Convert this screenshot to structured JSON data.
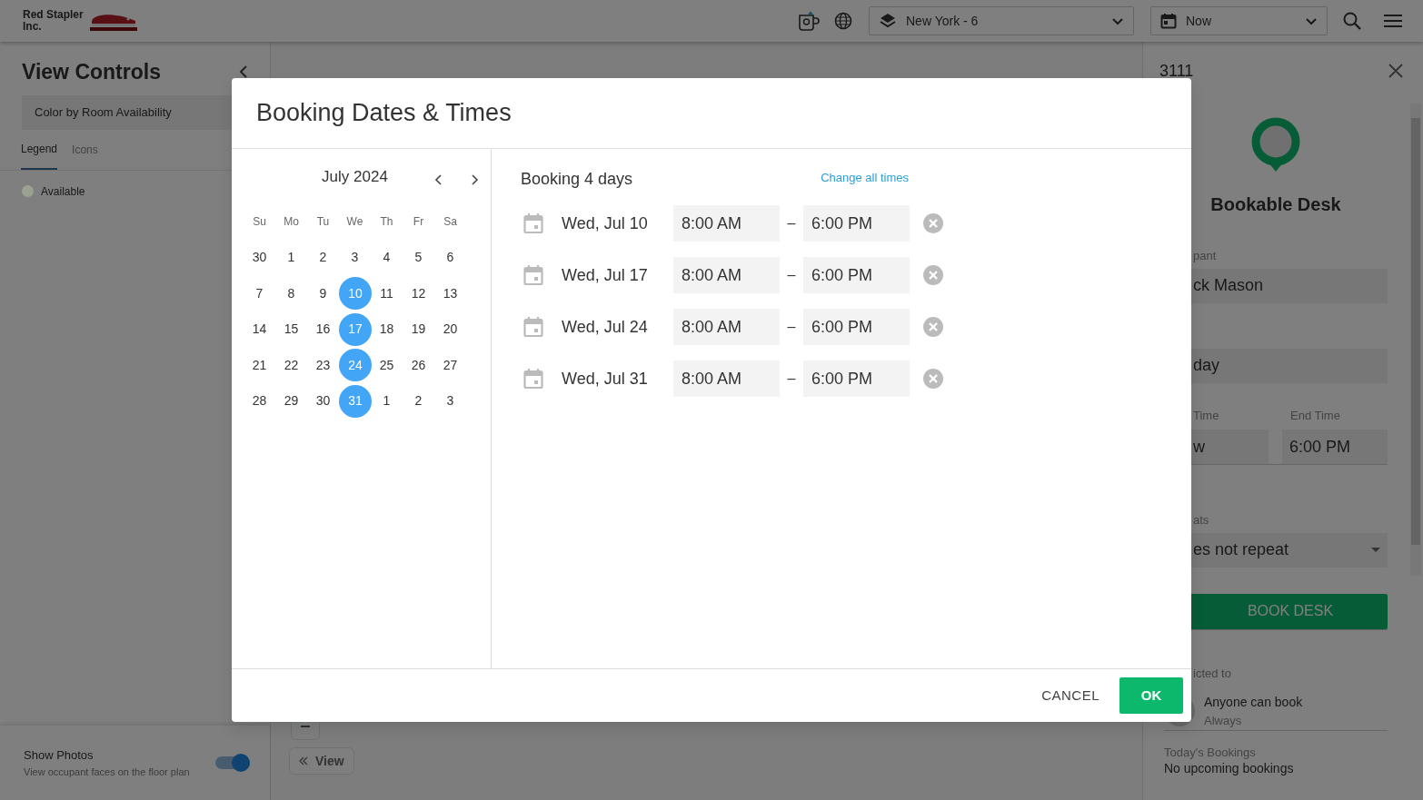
{
  "header": {
    "logo_text": "Red Stapler Inc.",
    "location_select": {
      "value": "New York - 6"
    },
    "time_select": {
      "value": "Now"
    }
  },
  "view_controls": {
    "title": "View Controls",
    "color_select": {
      "value": "Color by Room Availability"
    },
    "tabs": [
      {
        "label": "Legend",
        "selected": true
      },
      {
        "label": "Icons",
        "selected": false
      }
    ],
    "legend": [
      {
        "label": "Available",
        "color": "#9aa38f"
      }
    ],
    "show_photos": {
      "label": "Show Photos",
      "description": "View occupant faces on the floor plan",
      "on": true
    }
  },
  "floor_plan": {
    "view_button": {
      "label": "View"
    }
  },
  "details_panel": {
    "title": "3111",
    "type": "Bookable Desk",
    "occupant_label": "pant",
    "occupant_value": "ck Mason",
    "date_value": "day",
    "start_time_label": "Time",
    "start_time_value": "w",
    "end_time_label": "End Time",
    "end_time_value": "6:00 PM",
    "repeats_label": "ats",
    "repeats_value": "es not repeat",
    "book_button": "BOOK DESK",
    "restricted_label": "icted to",
    "restriction": {
      "title": "Anyone can book",
      "subtitle": "Always"
    },
    "todays_bookings_label": "Today's Bookings",
    "todays_bookings_value": "No upcoming bookings"
  },
  "dialog": {
    "title": "Booking Dates & Times",
    "calendar": {
      "month": "July 2024",
      "weekdays": [
        "Su",
        "Mo",
        "Tu",
        "We",
        "Th",
        "Fr",
        "Sa"
      ],
      "weeks": [
        [
          {
            "day": "30",
            "selected": false
          },
          {
            "day": "1",
            "selected": false
          },
          {
            "day": "2",
            "selected": false
          },
          {
            "day": "3",
            "selected": false
          },
          {
            "day": "4",
            "selected": false
          },
          {
            "day": "5",
            "selected": false
          },
          {
            "day": "6",
            "selected": false
          }
        ],
        [
          {
            "day": "7",
            "selected": false
          },
          {
            "day": "8",
            "selected": false
          },
          {
            "day": "9",
            "selected": false
          },
          {
            "day": "10",
            "selected": true
          },
          {
            "day": "11",
            "selected": false
          },
          {
            "day": "12",
            "selected": false
          },
          {
            "day": "13",
            "selected": false
          }
        ],
        [
          {
            "day": "14",
            "selected": false
          },
          {
            "day": "15",
            "selected": false
          },
          {
            "day": "16",
            "selected": false
          },
          {
            "day": "17",
            "selected": true
          },
          {
            "day": "18",
            "selected": false
          },
          {
            "day": "19",
            "selected": false
          },
          {
            "day": "20",
            "selected": false
          }
        ],
        [
          {
            "day": "21",
            "selected": false
          },
          {
            "day": "22",
            "selected": false
          },
          {
            "day": "23",
            "selected": false
          },
          {
            "day": "24",
            "selected": true
          },
          {
            "day": "25",
            "selected": false
          },
          {
            "day": "26",
            "selected": false
          },
          {
            "day": "27",
            "selected": false
          }
        ],
        [
          {
            "day": "28",
            "selected": false
          },
          {
            "day": "29",
            "selected": false
          },
          {
            "day": "30",
            "selected": false
          },
          {
            "day": "31",
            "selected": true
          },
          {
            "day": "1",
            "selected": false
          },
          {
            "day": "2",
            "selected": false
          },
          {
            "day": "3",
            "selected": false
          }
        ]
      ]
    },
    "summary": "Booking 4 days",
    "change_all_link": "Change all times",
    "bookings": [
      {
        "date": "Wed, Jul 10",
        "start": "8:00 AM",
        "separator": "–",
        "end": "6:00 PM"
      },
      {
        "date": "Wed, Jul 17",
        "start": "8:00 AM",
        "separator": "–",
        "end": "6:00 PM"
      },
      {
        "date": "Wed, Jul 24",
        "start": "8:00 AM",
        "separator": "–",
        "end": "6:00 PM"
      },
      {
        "date": "Wed, Jul 31",
        "start": "8:00 AM",
        "separator": "–",
        "end": "6:00 PM"
      }
    ],
    "buttons": [
      {
        "label": "CANCEL",
        "kind": "text"
      },
      {
        "label": "OK",
        "kind": "primary"
      }
    ]
  }
}
